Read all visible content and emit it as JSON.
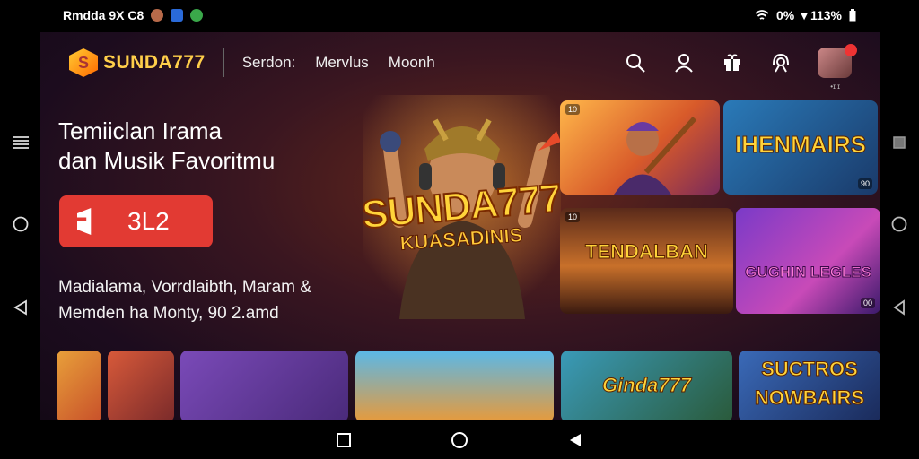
{
  "status_bar": {
    "left_text": "Rmdda 9X C8",
    "right_text": "0% ▼113%"
  },
  "header": {
    "logo_text": "SUNDA777",
    "nav": [
      "Serdon:",
      "Mervlus",
      "Moonh"
    ],
    "avatar_label": "•ɪ ɪ"
  },
  "hero": {
    "title_line1": "Temiiclan Irama",
    "title_line2": "dan Musik Favoritmu",
    "cta_label": "3L2",
    "desc_line1": "Madialama, Vorrdlaibth, Maram &",
    "desc_line2": "Memden ha Monty, 90 2.amd",
    "big_logo_line1": "SUNDA777",
    "big_logo_line2": "KUASADINIS"
  },
  "cards": {
    "c1_badge": "10",
    "c2_title": "IHENMAIRS",
    "c2_badge": "90",
    "c3_title": "TENDALBAN",
    "c3_badge": "10",
    "c4_title": "GUGHIN LEGLES",
    "c4_badge": "00",
    "b5_title": "Ginda777",
    "b6_title1": "SUCTROS",
    "b6_title2": "NOWBAIRS"
  },
  "colors": {
    "accent_red": "#e23a33",
    "gold": "#ffd43a",
    "background": "#1c0c1e"
  }
}
